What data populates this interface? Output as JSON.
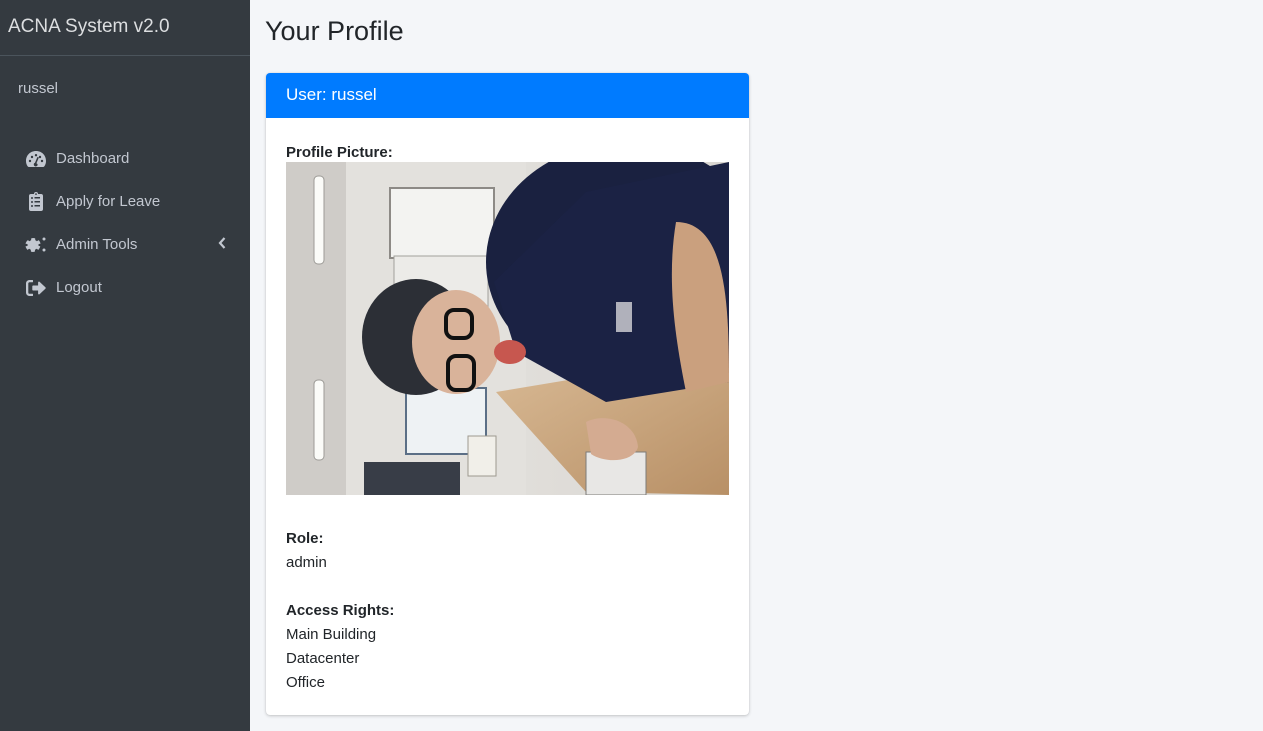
{
  "sidebar": {
    "brand": "ACNA System v2.0",
    "user": "russel",
    "items": [
      {
        "label": "Dashboard",
        "icon": "tachometer-icon"
      },
      {
        "label": "Apply for Leave",
        "icon": "clipboard-icon"
      },
      {
        "label": "Admin Tools",
        "icon": "gears-icon"
      },
      {
        "label": "Logout",
        "icon": "sign-out-icon"
      }
    ]
  },
  "main": {
    "title": "Your Profile",
    "card": {
      "header": "User: russel",
      "profile_picture_label": "Profile Picture:",
      "role_label": "Role:",
      "role_value": "admin",
      "access_label": "Access Rights:",
      "access_rights": [
        "Main Building",
        "Datacenter",
        "Office"
      ]
    }
  },
  "colors": {
    "sidebar_bg": "#343a40",
    "primary": "#007bff",
    "page_bg": "#f4f6f9"
  }
}
